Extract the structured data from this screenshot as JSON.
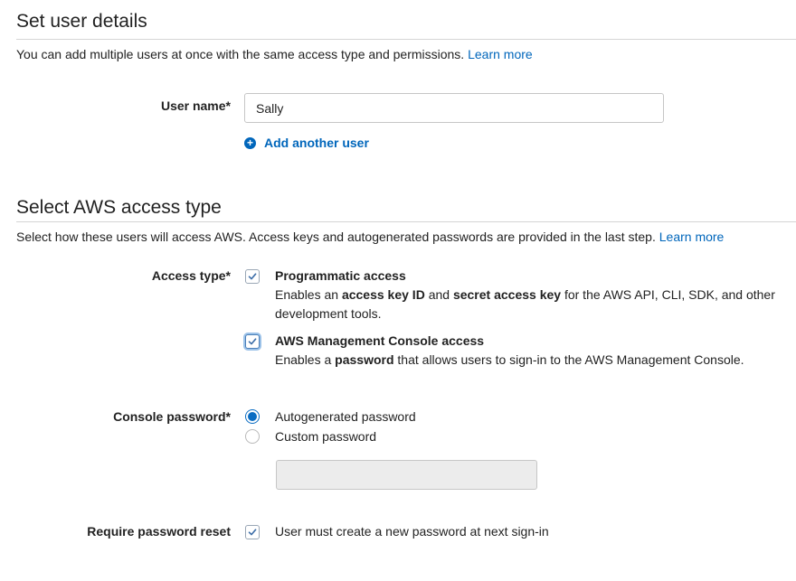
{
  "user_details": {
    "title": "Set user details",
    "description": "You can add multiple users at once with the same access type and permissions.",
    "learn_more": "Learn more",
    "username_label": "User name*",
    "username_value": "Sally",
    "add_another_user": "Add another user",
    "plus_icon_glyph": "+"
  },
  "access_type": {
    "title": "Select AWS access type",
    "description": "Select how these users will access AWS. Access keys and autogenerated passwords are provided in the last step.",
    "learn_more": "Learn more",
    "label": "Access type*",
    "programmatic": {
      "title": "Programmatic access",
      "checked": true,
      "desc_pre": "Enables an ",
      "desc_bold1": "access key ID",
      "desc_mid": " and ",
      "desc_bold2": "secret access key",
      "desc_post": " for the AWS API, CLI, SDK, and other development tools."
    },
    "console": {
      "title": "AWS Management Console access",
      "checked": true,
      "desc_pre": "Enables a ",
      "desc_bold": "password",
      "desc_post": " that allows users to sign-in to the AWS Management Console."
    }
  },
  "console_password": {
    "label": "Console password*",
    "options": [
      {
        "label": "Autogenerated password",
        "selected": true
      },
      {
        "label": "Custom password",
        "selected": false
      }
    ],
    "custom_value": ""
  },
  "password_reset": {
    "label": "Require password reset",
    "checkbox_label": "User must create a new password at next sign-in",
    "checked": true
  },
  "colors": {
    "link": "#0066bb",
    "accent": "#0a6cc2",
    "rule": "#d5d5d5",
    "disabled_bg": "#ececec"
  }
}
